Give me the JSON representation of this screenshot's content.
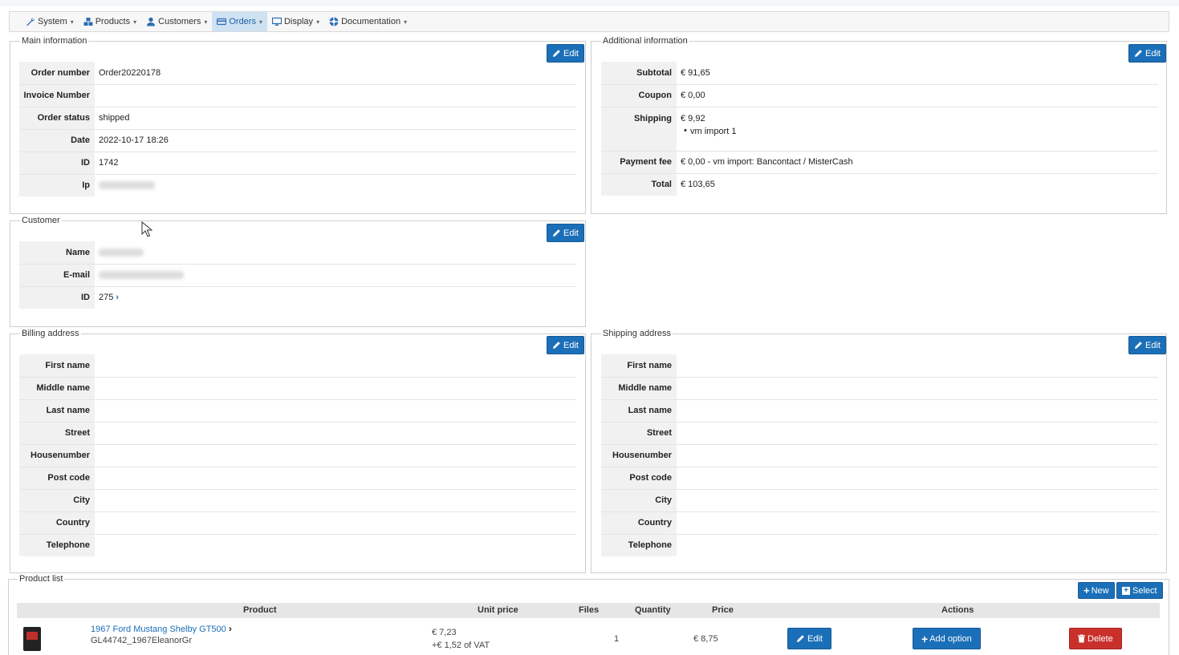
{
  "menu": {
    "items": [
      {
        "label": "System",
        "icon": "wrench-icon"
      },
      {
        "label": "Products",
        "icon": "cubes-icon"
      },
      {
        "label": "Customers",
        "icon": "user-icon"
      },
      {
        "label": "Orders",
        "icon": "credit-card-icon",
        "active": true
      },
      {
        "label": "Display",
        "icon": "monitor-icon"
      },
      {
        "label": "Documentation",
        "icon": "help-icon"
      }
    ]
  },
  "edit_label": "Edit",
  "main_info": {
    "title": "Main information",
    "rows": [
      {
        "key": "Order number",
        "value": "Order20220178"
      },
      {
        "key": "Invoice Number",
        "value": ""
      },
      {
        "key": "Order status",
        "value": "shipped"
      },
      {
        "key": "Date",
        "value": "2022-10-17 18:26"
      },
      {
        "key": "ID",
        "value": "1742"
      },
      {
        "key": "Ip",
        "value": ""
      }
    ]
  },
  "additional_info": {
    "title": "Additional information",
    "subtotal_key": "Subtotal",
    "subtotal": "€ 91,65",
    "coupon_key": "Coupon",
    "coupon": "€ 0,00",
    "shipping_key": "Shipping",
    "shipping": "€ 9,92",
    "shipping_method": "vm import 1",
    "payment_key": "Payment fee",
    "payment": "€ 0,00 - vm import: Bancontact / MisterCash",
    "total_key": "Total",
    "total": "€ 103,65"
  },
  "customer": {
    "title": "Customer",
    "name_key": "Name",
    "email_key": "E-mail",
    "id_key": "ID",
    "id": "275"
  },
  "billing": {
    "title": "Billing address",
    "rows": [
      "First name",
      "Middle name",
      "Last name",
      "Street",
      "Housenumber",
      "Post code",
      "City",
      "Country",
      "Telephone"
    ]
  },
  "shipping_addr": {
    "title": "Shipping address",
    "rows": [
      "First name",
      "Middle name",
      "Last name",
      "Street",
      "Housenumber",
      "Post code",
      "City",
      "Country",
      "Telephone"
    ]
  },
  "product_list": {
    "title": "Product list",
    "new_label": "New",
    "select_label": "Select",
    "columns": {
      "product": "Product",
      "unit_price": "Unit price",
      "files": "Files",
      "quantity": "Quantity",
      "price": "Price",
      "actions": "Actions"
    },
    "items": [
      {
        "name": "1967 Ford Mustang Shelby GT500",
        "sku": "GL44742_1967EleanorGr",
        "unit_price": "€ 7,23",
        "vat": "+€ 1,52 of VAT",
        "quantity": "1",
        "price": "€ 8,75",
        "edit_label": "Edit",
        "add_option_label": "Add option",
        "delete_label": "Delete"
      }
    ]
  }
}
